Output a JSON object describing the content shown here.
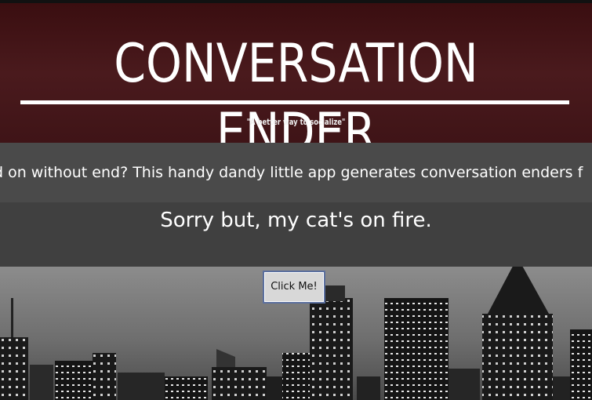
{
  "header": {
    "title": "CONVERSATION ENDER",
    "tagline": "\"A better way to socialize\""
  },
  "ticker": {
    "text": "d on without end? This handy dandy little app generates conversation enders f"
  },
  "result": {
    "text": "Sorry but, my cat's on fire."
  },
  "actions": {
    "click_label": "Click Me!"
  },
  "colors": {
    "header_bg": "#4a1a1d",
    "ticker_bg": "#4a4a4a",
    "result_bg": "#404040",
    "button_border": "#5b6f9e"
  }
}
